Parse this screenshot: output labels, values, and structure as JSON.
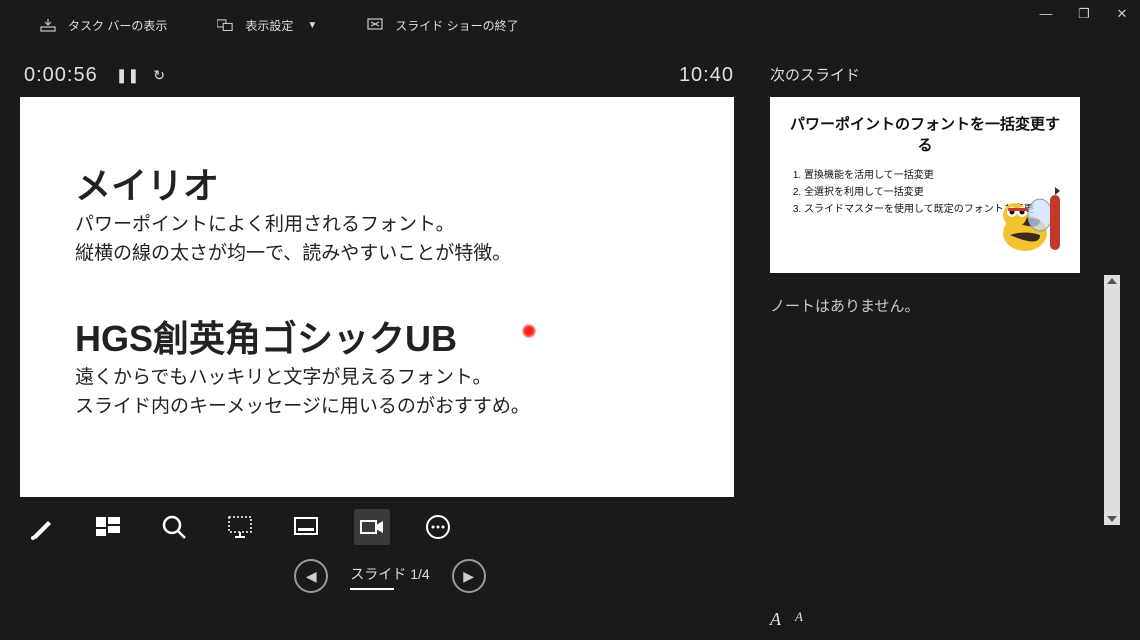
{
  "topbar": {
    "taskbar_label": "タスク バーの表示",
    "display_settings_label": "表示設定",
    "end_show_label": "スライド ショーの終了"
  },
  "timer": {
    "elapsed": "0:00:56",
    "clock": "10:40"
  },
  "current_slide": {
    "block1_title": "メイリオ",
    "block1_line1": "パワーポイントによく利用されるフォント。",
    "block1_line2": "縦横の線の太さが均一で、読みやすいことが特徴。",
    "block2_title": "HGS創英角ゴシックUB",
    "block2_line1": "遠くからでもハッキリと文字が見えるフォント。",
    "block2_line2": "スライド内のキーメッセージに用いるのがおすすめ。"
  },
  "next_slide": {
    "section_label": "次のスライド",
    "title": "パワーポイントのフォントを一括変更する",
    "items": [
      "置換機能を活用して一括変更",
      "全選択を利用して一括変更",
      "スライドマスターを使用して既定のフォントを変更"
    ]
  },
  "notes": {
    "empty_text": "ノートはありません。"
  },
  "nav": {
    "counter_prefix": "スライド",
    "current": 1,
    "total": 4
  },
  "font_ctrl": {
    "big": "A",
    "small": "A"
  }
}
